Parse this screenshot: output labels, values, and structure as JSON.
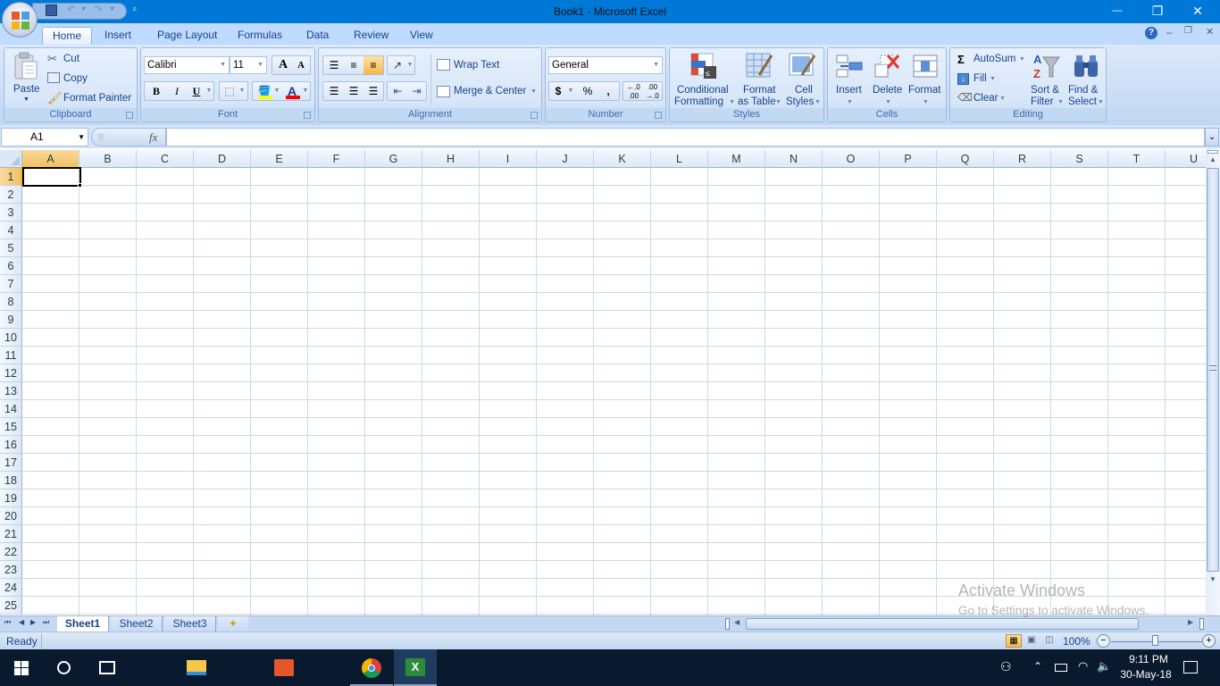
{
  "window": {
    "title": "Book1 - Microsoft Excel",
    "minimize": "—",
    "restore": "❐",
    "close": "✕"
  },
  "qat": {
    "save_icon": "save-icon",
    "undo_icon": "undo-icon",
    "redo_icon": "redo-icon",
    "customize_icon": "customize-qat-icon"
  },
  "tabs": [
    {
      "label": "Home",
      "active": true
    },
    {
      "label": "Insert"
    },
    {
      "label": "Page Layout"
    },
    {
      "label": "Formulas"
    },
    {
      "label": "Data"
    },
    {
      "label": "Review"
    },
    {
      "label": "View"
    }
  ],
  "ribbon_controls": {
    "help": "?",
    "min": "–",
    "restore": "❐",
    "close": "✕"
  },
  "clipboard": {
    "label": "Clipboard",
    "paste": "Paste",
    "cut": "Cut",
    "copy": "Copy",
    "format_painter": "Format Painter"
  },
  "font": {
    "label": "Font",
    "font_name": "Calibri",
    "font_size": "11",
    "grow": "A",
    "shrink": "A",
    "bold": "B",
    "italic": "I",
    "underline": "U",
    "fill_color": "#ffff00",
    "font_color": "#ff0000"
  },
  "alignment": {
    "label": "Alignment",
    "wrap_text": "Wrap Text",
    "merge_center": "Merge & Center"
  },
  "number": {
    "label": "Number",
    "format": "General",
    "currency": "$",
    "percent": "%",
    "comma": ",",
    "inc_decimal": "+.0 .00",
    "dec_decimal": ".00 +.0"
  },
  "styles": {
    "label": "Styles",
    "conditional_1": "Conditional",
    "conditional_2": "Formatting",
    "format_table_1": "Format",
    "format_table_2": "as Table",
    "cell_styles_1": "Cell",
    "cell_styles_2": "Styles"
  },
  "cells": {
    "label": "Cells",
    "insert": "Insert",
    "delete": "Delete",
    "format": "Format"
  },
  "editing": {
    "label": "Editing",
    "autosum": "AutoSum",
    "fill": "Fill",
    "clear": "Clear",
    "sort_1": "Sort &",
    "sort_2": "Filter",
    "find_1": "Find &",
    "find_2": "Select"
  },
  "formula_bar": {
    "name_box": "A1",
    "fx": "fx",
    "formula": ""
  },
  "grid": {
    "columns": [
      "A",
      "B",
      "C",
      "D",
      "E",
      "F",
      "G",
      "H",
      "I",
      "J",
      "K",
      "L",
      "M",
      "N",
      "O",
      "P",
      "Q",
      "R",
      "S",
      "T",
      "U"
    ],
    "rows": [
      "1",
      "2",
      "3",
      "4",
      "5",
      "6",
      "7",
      "8",
      "9",
      "10",
      "11",
      "12",
      "13",
      "14",
      "15",
      "16",
      "17",
      "18",
      "19",
      "20",
      "21",
      "22",
      "23",
      "24",
      "25"
    ],
    "active_cell": "A1"
  },
  "sheets": [
    {
      "label": "Sheet1",
      "active": true
    },
    {
      "label": "Sheet2"
    },
    {
      "label": "Sheet3"
    }
  ],
  "status": {
    "text": "Ready",
    "zoom": "100%"
  },
  "watermark": {
    "line1": "Activate Windows",
    "line2": "Go to Settings to activate Windows."
  },
  "taskbar": {
    "time": "9:11 PM",
    "date": "30-May-18"
  }
}
